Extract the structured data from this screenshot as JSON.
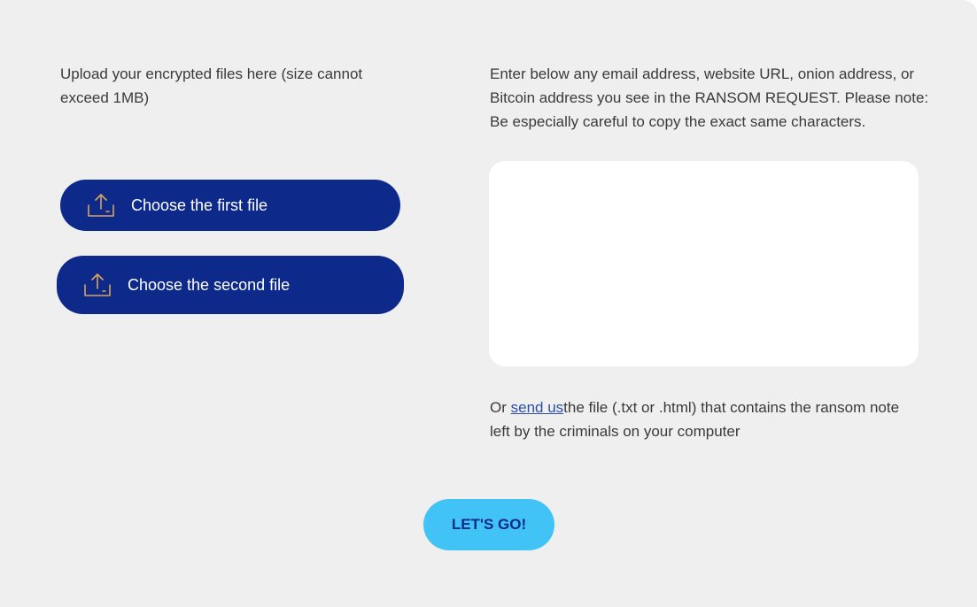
{
  "upload": {
    "description": "Upload your encrypted files here (size cannot exceed 1MB)",
    "first_button": "Choose the first file",
    "second_button": "Choose the second file",
    "icon": "upload-icon"
  },
  "ransom": {
    "description": "Enter below any email address, website URL, onion address, or Bitcoin address you see in the RANSOM REQUEST. Please note: Be especially careful to copy the exact same characters.",
    "input_value": ""
  },
  "alternative": {
    "prefix": "Or ",
    "link": "send us",
    "suffix": "the file (.txt or .html) that contains the ransom note left by the criminals on your computer"
  },
  "submit": {
    "label": "LET'S GO!"
  },
  "colors": {
    "panel_bg": "#efefef",
    "button_bg": "#0d2a8a",
    "icon_color": "#d9a35c",
    "submit_bg": "#41c3f5",
    "link": "#2b4fa8"
  }
}
